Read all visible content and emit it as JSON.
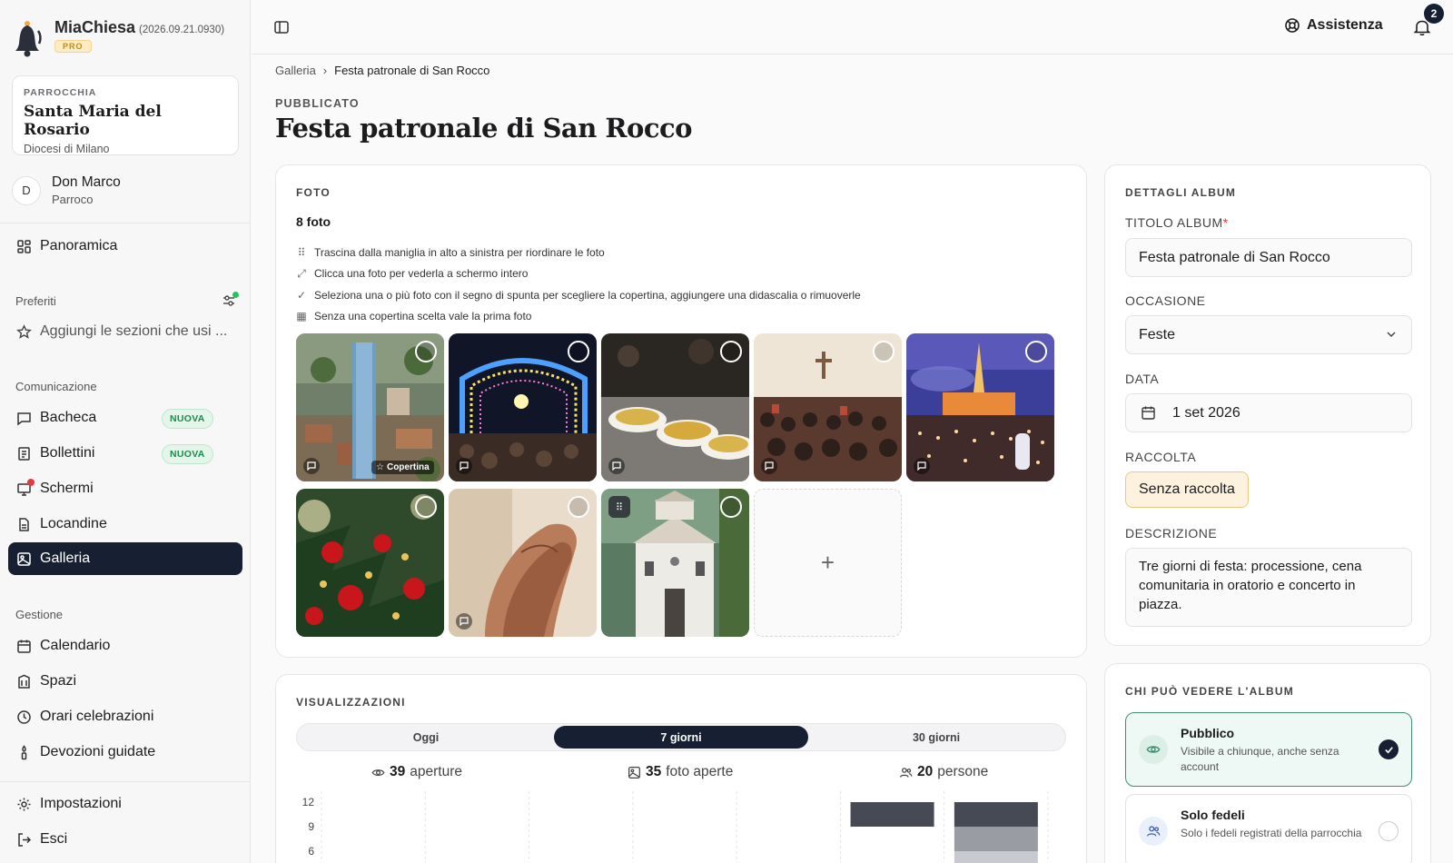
{
  "app": {
    "name": "MiaChiesa",
    "version": "(2026.09.21.0930)",
    "plan_badge": "PRO"
  },
  "parish": {
    "tag": "PARROCCHIA",
    "name": "Santa Maria del Rosario",
    "diocese": "Diocesi di Milano"
  },
  "user": {
    "initial": "D",
    "name": "Don Marco",
    "role": "Parroco"
  },
  "sidebar": {
    "overview": "Panoramica",
    "favorites_label": "Preferiti",
    "favorites_add": "Aggiungi le sezioni che usi ...",
    "communication_label": "Comunicazione",
    "communication": [
      {
        "label": "Bacheca",
        "badge": "NUOVA",
        "icon": "message-square-icon"
      },
      {
        "label": "Bollettini",
        "badge": "NUOVA",
        "icon": "newspaper-icon"
      },
      {
        "label": "Schermi",
        "icon": "monitor-icon"
      },
      {
        "label": "Locandine",
        "icon": "file-icon"
      },
      {
        "label": "Galleria",
        "icon": "gallery-icon",
        "active": true
      }
    ],
    "management_label": "Gestione",
    "management": [
      {
        "label": "Calendario",
        "icon": "calendar-icon"
      },
      {
        "label": "Spazi",
        "icon": "building-icon"
      },
      {
        "label": "Orari celebrazioni",
        "icon": "clock-icon"
      },
      {
        "label": "Devozioni guidate",
        "icon": "candle-icon"
      }
    ],
    "settings": "Impostazioni",
    "logout": "Esci"
  },
  "topbar": {
    "help": "Assistenza",
    "notifications_count": "2"
  },
  "breadcrumb": {
    "parent": "Galleria",
    "current": "Festa patronale di San Rocco"
  },
  "page": {
    "status": "PUBBLICATO",
    "title": "Festa patronale di San Rocco"
  },
  "photos": {
    "section_label": "FOTO",
    "count": "8 foto",
    "tips": [
      "Trascina dalla maniglia in alto a sinistra per riordinare le foto",
      "Clicca una foto per vederla a schermo intero",
      "Seleziona una o più foto con il segno di spunta per scegliere la copertina, aggiungere una didascalia o rimuoverle",
      "Senza una copertina scelta vale la prima foto"
    ],
    "cover_label": "Copertina",
    "items": [
      {
        "subject": "aerial-town-tower",
        "cover": true
      },
      {
        "subject": "festival-lights-arch"
      },
      {
        "subject": "pasta-bowls"
      },
      {
        "subject": "church-congregation"
      },
      {
        "subject": "night-basilica-candles"
      },
      {
        "subject": "christmas-tree-ornaments"
      },
      {
        "subject": "praying-hands"
      },
      {
        "subject": "white-chapel"
      }
    ]
  },
  "details": {
    "section_label": "DETTAGLI ALBUM",
    "title_label": "TITOLO ALBUM",
    "title_value": "Festa patronale di San Rocco",
    "occasion_label": "OCCASIONE",
    "occasion_value": "Feste",
    "date_label": "DATA",
    "date_value": "1 set 2026",
    "collection_label": "RACCOLTA",
    "collection_value": "Senza raccolta",
    "description_label": "DESCRIZIONE",
    "description_value": "Tre giorni di festa: processione, cena comunitaria in oratorio e concerto in piazza."
  },
  "visibility": {
    "section_label": "CHI PUÒ VEDERE L'ALBUM",
    "options": [
      {
        "title": "Pubblico",
        "desc": "Visibile a chiunque, anche senza account",
        "selected": true
      },
      {
        "title": "Solo fedeli",
        "desc": "Solo i fedeli registrati della parrocchia",
        "selected": false
      }
    ]
  },
  "views": {
    "section_label": "VISUALIZZAZIONI",
    "ranges": [
      "Oggi",
      "7 giorni",
      "30 giorni"
    ],
    "active_range": "7 giorni",
    "stats": [
      {
        "value": "39",
        "label": "aperture",
        "icon": "eye-icon"
      },
      {
        "value": "35",
        "label": "foto aperte",
        "icon": "image-icon"
      },
      {
        "value": "20",
        "label": "persone",
        "icon": "users-icon"
      }
    ]
  },
  "colors": {
    "accent_dark": "#172032",
    "badge_green": "#1d8d4d",
    "pro_gold": "#c58a17",
    "selected_bg": "#eef8f4"
  },
  "chart_data": {
    "type": "bar",
    "y_ticks": [
      "12",
      "9",
      "6"
    ],
    "ylim": [
      0,
      12
    ],
    "categories": [
      "",
      "",
      "",
      "",
      "",
      "",
      ""
    ],
    "series": [
      {
        "values": [
          0,
          0,
          0,
          0,
          0,
          3,
          3
        ]
      },
      {
        "values": [
          0,
          0,
          0,
          0,
          0,
          0,
          3
        ]
      },
      {
        "values": [
          0,
          0,
          0,
          0,
          0,
          0,
          4
        ]
      }
    ]
  }
}
